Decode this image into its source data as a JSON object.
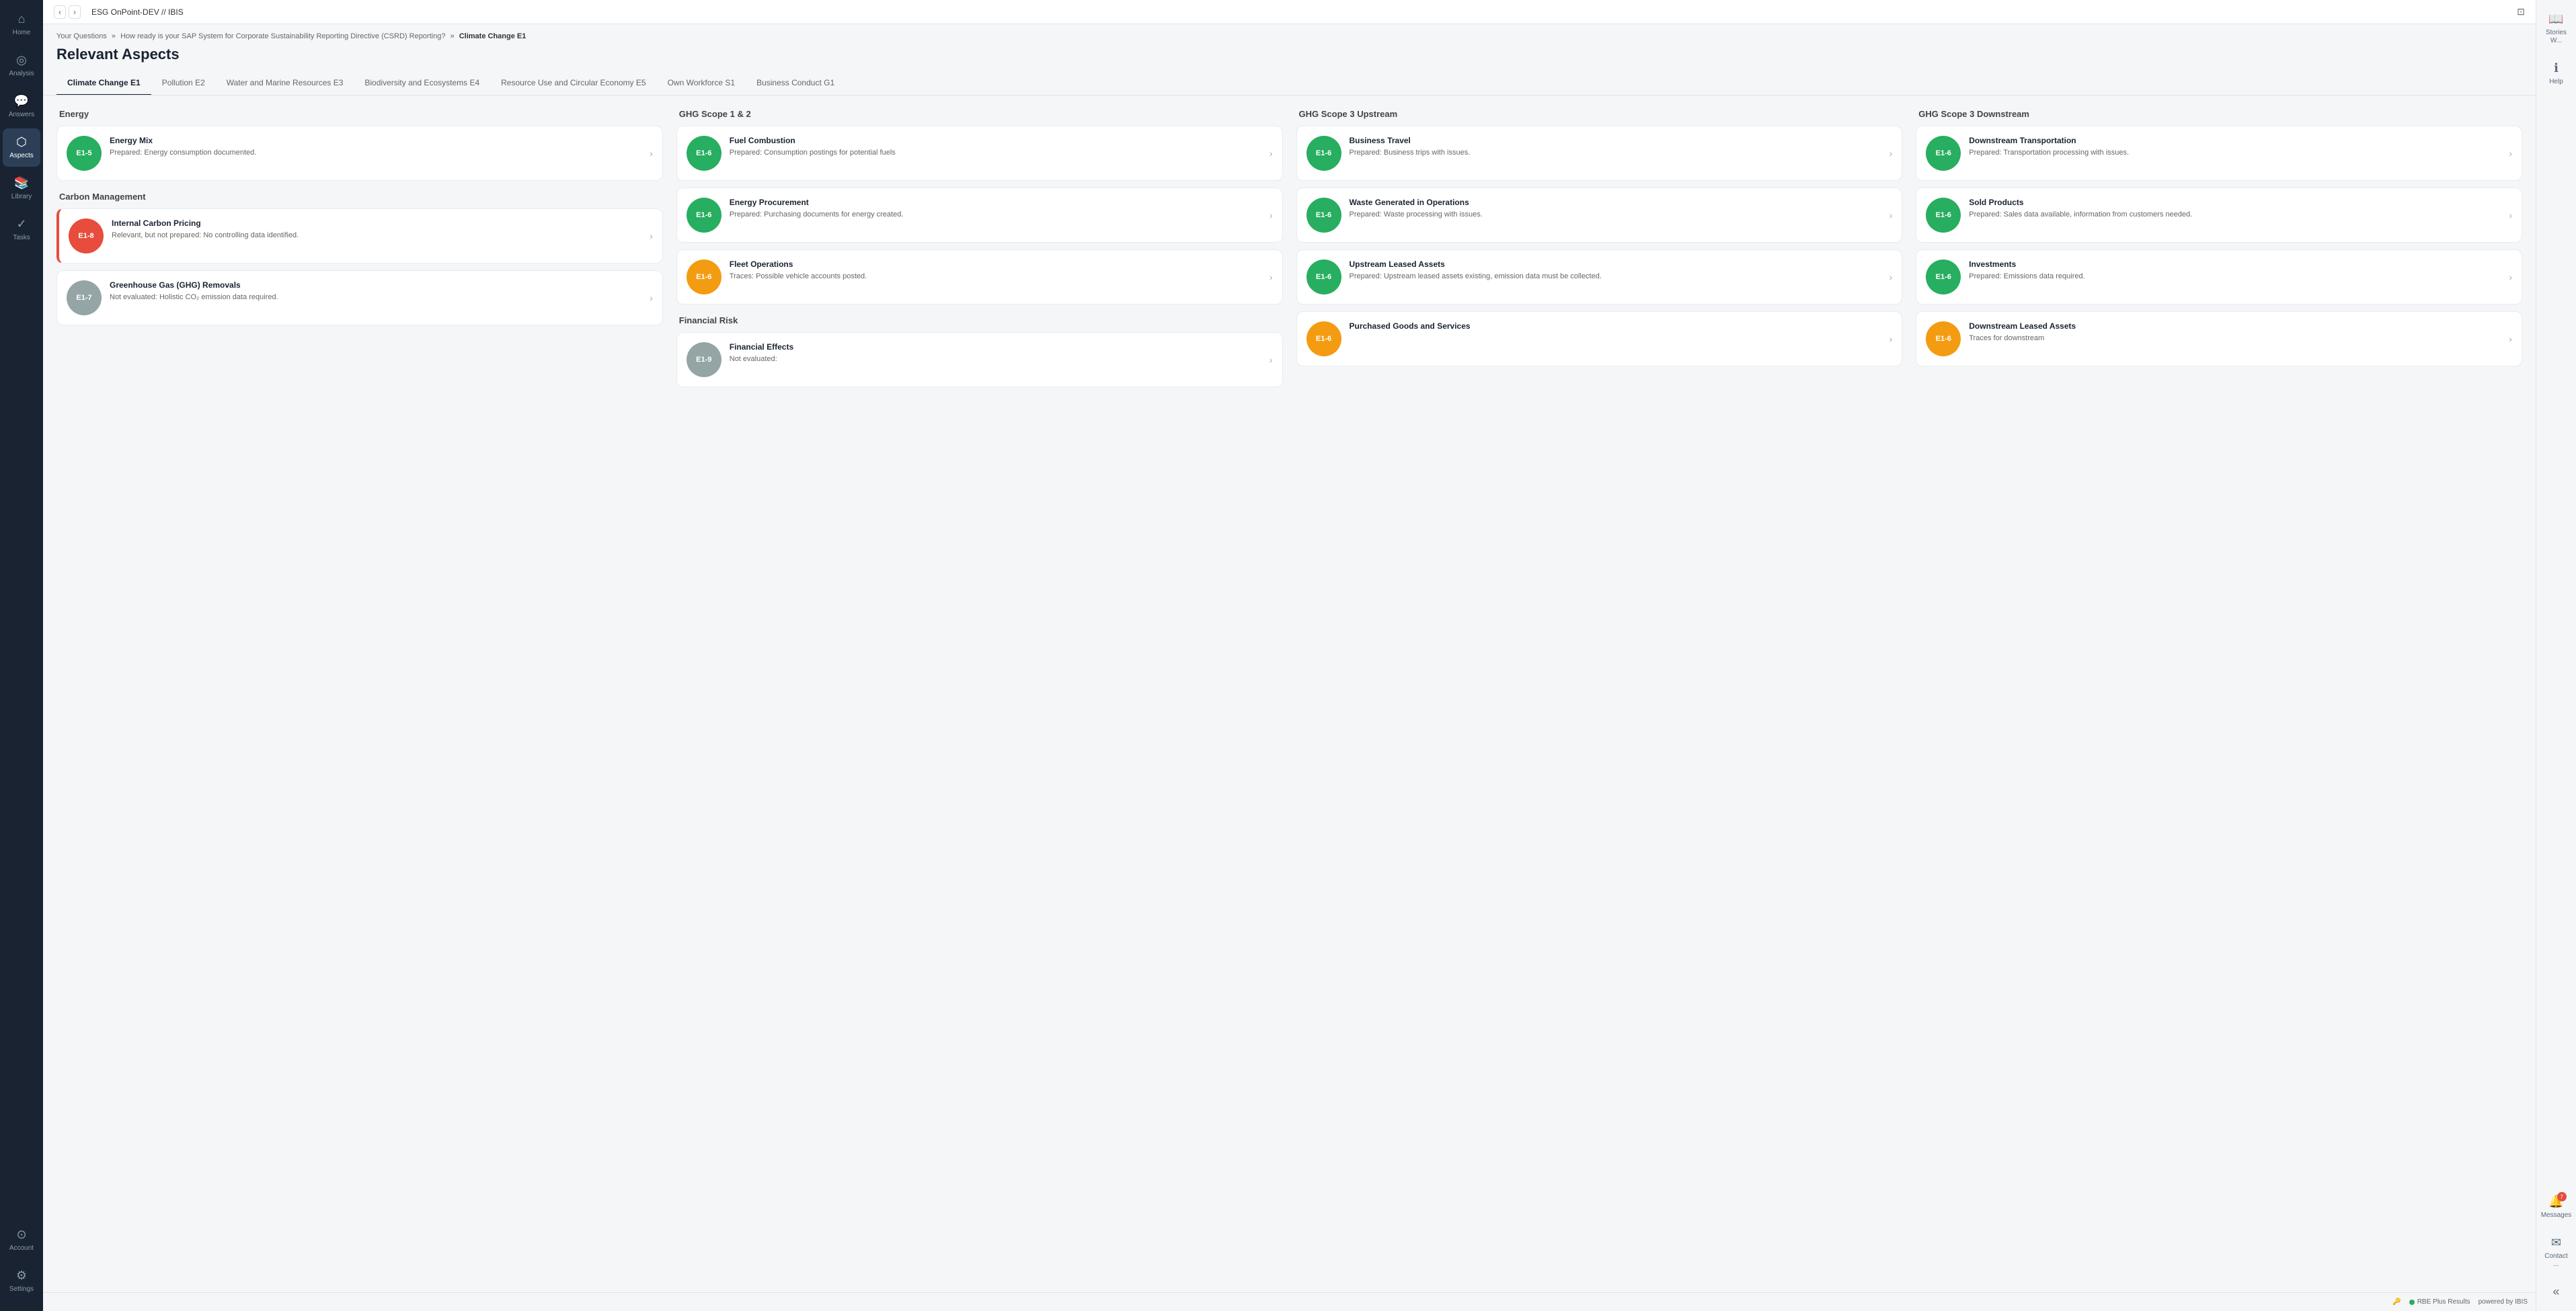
{
  "topbar": {
    "back_label": "‹",
    "forward_label": "›",
    "title": "ESG OnPoint-DEV // IBIS",
    "window_btn": "⊡"
  },
  "breadcrumb": {
    "part1": "Your Questions",
    "sep1": "»",
    "part2": "How ready is your SAP System for Corporate Sustainability Reporting Directive (CSRD) Reporting?",
    "sep2": "»",
    "current": "Climate Change E1"
  },
  "page_title": "Relevant Aspects",
  "tabs": [
    {
      "id": "climate",
      "label": "Climate Change E1",
      "active": true
    },
    {
      "id": "pollution",
      "label": "Pollution E2",
      "active": false
    },
    {
      "id": "water",
      "label": "Water and Marine Resources E3",
      "active": false
    },
    {
      "id": "biodiversity",
      "label": "Biodiversity and Ecosystems E4",
      "active": false
    },
    {
      "id": "resource",
      "label": "Resource Use and Circular Economy E5",
      "active": false
    },
    {
      "id": "workforce",
      "label": "Own Workforce S1",
      "active": false
    },
    {
      "id": "business",
      "label": "Business Conduct G1",
      "active": false
    }
  ],
  "sidebar": {
    "items": [
      {
        "id": "home",
        "icon": "⌂",
        "label": "Home",
        "active": false
      },
      {
        "id": "analysis",
        "icon": "◎",
        "label": "Analysis",
        "active": false
      },
      {
        "id": "answers",
        "icon": "💬",
        "label": "Answers",
        "active": false
      },
      {
        "id": "aspects",
        "icon": "⬡",
        "label": "Aspects",
        "active": true
      },
      {
        "id": "library",
        "icon": "📚",
        "label": "Library",
        "active": false
      },
      {
        "id": "tasks",
        "icon": "✓",
        "label": "Tasks",
        "active": false
      }
    ],
    "bottom_items": [
      {
        "id": "account",
        "icon": "⊙",
        "label": "Account",
        "active": false
      },
      {
        "id": "settings",
        "icon": "⚙",
        "label": "Settings",
        "active": false
      }
    ]
  },
  "right_sidebar": {
    "items": [
      {
        "id": "stories",
        "icon": "📖",
        "label": "Stories W...",
        "badge": null
      },
      {
        "id": "help",
        "icon": "ℹ",
        "label": "Help",
        "badge": null
      }
    ],
    "bottom_items": [
      {
        "id": "messages",
        "icon": "🔔",
        "label": "Messages",
        "badge": "7"
      },
      {
        "id": "contact",
        "icon": "✉",
        "label": "Contact ...",
        "badge": null
      },
      {
        "id": "collapse",
        "icon": "«",
        "label": "",
        "badge": null
      }
    ]
  },
  "columns": [
    {
      "id": "energy",
      "title": "Energy",
      "cards": [
        {
          "id": "e1-5-energy-mix",
          "badge_text": "E1-5",
          "badge_color": "green",
          "title": "Energy Mix",
          "desc": "Prepared: Energy consumption documented.",
          "has_red_border": false
        }
      ]
    },
    {
      "id": "carbon",
      "title": "Carbon Management",
      "cards": [
        {
          "id": "e1-8-carbon",
          "badge_text": "E1-8",
          "badge_color": "red",
          "title": "Internal Carbon Pricing",
          "desc": "Relevant, but not prepared: No controlling data identified.",
          "has_red_border": true
        },
        {
          "id": "e1-7-ghg",
          "badge_text": "E1-7",
          "badge_color": "gray",
          "title": "Greenhouse Gas (GHG) Removals",
          "desc": "Not evaluated: Holistic CO₂ emission data required.",
          "has_red_border": false
        }
      ]
    },
    {
      "id": "ghg12",
      "title": "GHG Scope 1 & 2",
      "cards": [
        {
          "id": "e1-6-fuel",
          "badge_text": "E1-6",
          "badge_color": "green",
          "title": "Fuel Combustion",
          "desc": "Prepared: Consumption postings for potential fuels",
          "has_red_border": false
        },
        {
          "id": "e1-6-energy-proc",
          "badge_text": "E1-6",
          "badge_color": "green",
          "title": "Energy Procurement",
          "desc": "Prepared: Purchasing documents for energy created.",
          "has_red_border": false
        },
        {
          "id": "e1-6-fleet",
          "badge_text": "E1-6",
          "badge_color": "yellow",
          "title": "Fleet Operations",
          "desc": "Traces: Possible vehicle accounts posted.",
          "has_red_border": false
        }
      ]
    },
    {
      "id": "financial",
      "title": "Financial Risk",
      "cards": [
        {
          "id": "e1-9-financial",
          "badge_text": "E1-9",
          "badge_color": "gray",
          "title": "Financial Effects",
          "desc": "Not evaluated:",
          "has_red_border": false
        }
      ]
    },
    {
      "id": "ghg3up",
      "title": "GHG Scope 3 Upstream",
      "cards": [
        {
          "id": "e1-6-travel",
          "badge_text": "E1-6",
          "badge_color": "green",
          "title": "Business Travel",
          "desc": "Prepared: Business trips with issues.",
          "has_red_border": false
        },
        {
          "id": "e1-6-waste",
          "badge_text": "E1-6",
          "badge_color": "green",
          "title": "Waste Generated in Operations",
          "desc": "Prepared: Waste processing with issues.",
          "has_red_border": false
        },
        {
          "id": "e1-6-upstream",
          "badge_text": "E1-6",
          "badge_color": "green",
          "title": "Upstream Leased Assets",
          "desc": "Prepared: Upstream leased assets existing, emission data must be collected.",
          "has_red_border": false
        },
        {
          "id": "e1-6-purchased",
          "badge_text": "E1-6",
          "badge_color": "yellow",
          "title": "Purchased Goods and Services",
          "desc": "",
          "has_red_border": false
        }
      ]
    },
    {
      "id": "ghg3down",
      "title": "GHG Scope 3 Downstream",
      "cards": [
        {
          "id": "e1-6-downstream-trans",
          "badge_text": "E1-6",
          "badge_color": "green",
          "title": "Downstream Transportation",
          "desc": "Prepared: Transportation processing with issues.",
          "has_red_border": false
        },
        {
          "id": "e1-6-sold",
          "badge_text": "E1-6",
          "badge_color": "green",
          "title": "Sold Products",
          "desc": "Prepared: Sales data available, information from customers needed.",
          "has_red_border": false
        },
        {
          "id": "e1-6-investments",
          "badge_text": "E1-6",
          "badge_color": "green",
          "title": "Investments",
          "desc": "Prepared: Emissions data required.",
          "has_red_border": false
        },
        {
          "id": "e1-6-downstream-lease",
          "badge_text": "E1-6",
          "badge_color": "yellow",
          "title": "Downstream Leased Assets",
          "desc": "Traces for downstream",
          "has_red_border": false
        }
      ]
    }
  ],
  "status_bar": {
    "rbe_label": "RBE Plus Results",
    "powered_label": "powered by IBIS"
  }
}
